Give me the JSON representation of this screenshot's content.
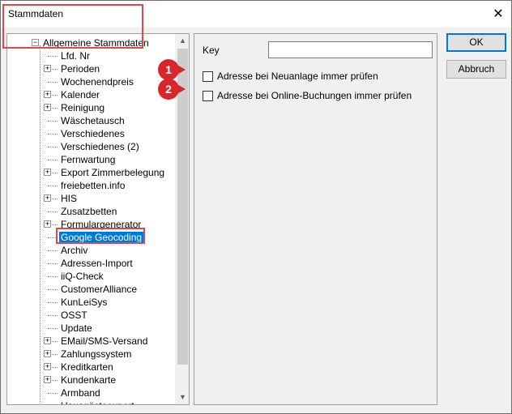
{
  "window": {
    "title": "Stammdaten",
    "close_glyph": "✕"
  },
  "tree": {
    "root_label": "Allgemeine Stammdaten",
    "items": [
      {
        "label": "Lfd. Nr",
        "expandable": false
      },
      {
        "label": "Perioden",
        "expandable": true
      },
      {
        "label": "Wochenendpreis",
        "expandable": false
      },
      {
        "label": "Kalender",
        "expandable": true
      },
      {
        "label": "Reinigung",
        "expandable": true
      },
      {
        "label": "Wäschetausch",
        "expandable": false
      },
      {
        "label": "Verschiedenes",
        "expandable": false
      },
      {
        "label": "Verschiedenes (2)",
        "expandable": false
      },
      {
        "label": "Fernwartung",
        "expandable": false
      },
      {
        "label": "Export Zimmerbelegung",
        "expandable": true
      },
      {
        "label": "freiebetten.info",
        "expandable": false
      },
      {
        "label": "HIS",
        "expandable": true
      },
      {
        "label": "Zusatzbetten",
        "expandable": false
      },
      {
        "label": "Formulargenerator",
        "expandable": true
      },
      {
        "label": "Google Geocoding",
        "expandable": false,
        "selected": true
      },
      {
        "label": "Archiv",
        "expandable": false
      },
      {
        "label": "Adressen-Import",
        "expandable": false
      },
      {
        "label": "iiQ-Check",
        "expandable": false
      },
      {
        "label": "CustomerAlliance",
        "expandable": false
      },
      {
        "label": "KunLeiSys",
        "expandable": false
      },
      {
        "label": "OSST",
        "expandable": false
      },
      {
        "label": "Update",
        "expandable": false
      },
      {
        "label": "EMail/SMS-Versand",
        "expandable": true
      },
      {
        "label": "Zahlungssystem",
        "expandable": true
      },
      {
        "label": "Kreditkarten",
        "expandable": true
      },
      {
        "label": "Kundenkarte",
        "expandable": true
      },
      {
        "label": "Armband",
        "expandable": false
      },
      {
        "label": "Hausgästeexport",
        "expandable": false
      }
    ],
    "expander_glyph": "+",
    "collapse_glyph": "−"
  },
  "settings": {
    "key_label": "Key",
    "key_value": "",
    "checkbox_new_address": "Adresse bei Neuanlage immer prüfen",
    "checkbox_online_booking": "Adresse bei Online-Buchungen immer prüfen"
  },
  "buttons": {
    "ok": "OK",
    "cancel": "Abbruch"
  },
  "annotations": {
    "badge_1": "1",
    "badge_2": "2",
    "highlight_color": "#e0474a",
    "badge_color": "#d9262c"
  },
  "colors": {
    "selection": "#0078d7",
    "dialog_bg": "#f0f0f0"
  }
}
